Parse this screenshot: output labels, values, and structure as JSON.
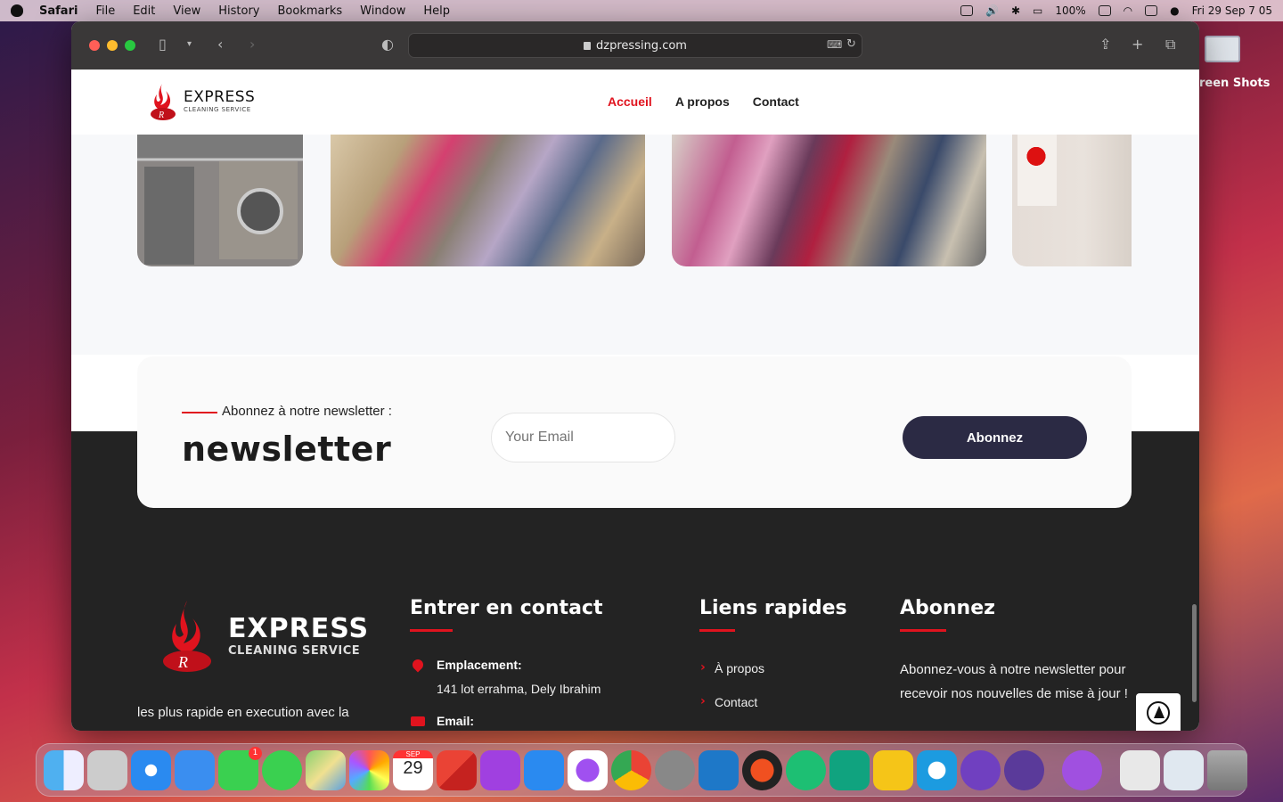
{
  "menubar": {
    "app": "Safari",
    "items": [
      "File",
      "Edit",
      "View",
      "History",
      "Bookmarks",
      "Window",
      "Help"
    ],
    "battery": "100%",
    "clock": "Fri 29 Sep  7 05"
  },
  "desktop": {
    "folder_label": "reen Shots"
  },
  "browser": {
    "url": "dzpressing.com"
  },
  "site": {
    "logo_title": "EXPRESS",
    "logo_subtitle": "CLEANING SERVICE",
    "nav": [
      {
        "label": "Accueil",
        "active": true
      },
      {
        "label": "A propos",
        "active": false
      },
      {
        "label": "Contact",
        "active": false
      }
    ]
  },
  "newsletter": {
    "kicker": "Abonnez à notre newsletter :",
    "title": "newsletter",
    "email_placeholder": "Your Email",
    "button": "Abonnez"
  },
  "footer": {
    "logo_title": "EXPRESS",
    "logo_subtitle": "CLEANING SERVICE",
    "description": "les plus rapide en execution avec la meilleurs prestation",
    "contact": {
      "title": "Entrer en contact",
      "location_label": "Emplacement:",
      "location_value": "141 lot errahma, Dely Ibrahim",
      "email_label": "Email:"
    },
    "links": {
      "title": "Liens rapides",
      "items": [
        "À propos",
        "Contact"
      ]
    },
    "subscribe": {
      "title": "Abonnez",
      "text": "Abonnez-vous à notre newsletter pour recevoir nos nouvelles de mise à jour !"
    }
  },
  "dock": {
    "calendar_month": "SEP",
    "calendar_day": "29",
    "facetime_badge": "1"
  },
  "colors": {
    "accent": "#e0131e",
    "button": "#2b2a44",
    "footer_bg": "#232323"
  }
}
